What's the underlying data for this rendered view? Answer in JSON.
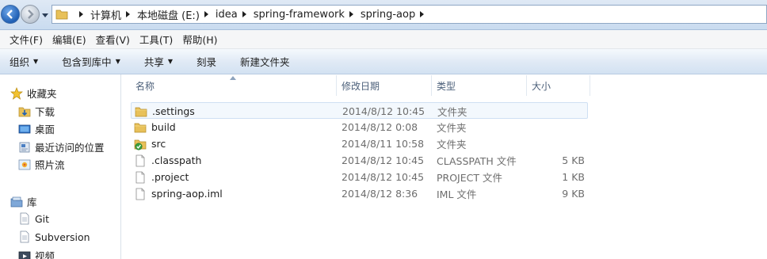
{
  "address": {
    "crumbs": [
      "计算机",
      "本地磁盘 (E:)",
      "idea",
      "spring-framework",
      "spring-aop"
    ]
  },
  "menu": [
    "文件(F)",
    "编辑(E)",
    "查看(V)",
    "工具(T)",
    "帮助(H)"
  ],
  "commands": [
    {
      "label": "组织",
      "dropdown": true
    },
    {
      "label": "包含到库中",
      "dropdown": true
    },
    {
      "label": "共享",
      "dropdown": true
    },
    {
      "label": "刻录",
      "dropdown": false
    },
    {
      "label": "新建文件夹",
      "dropdown": false
    }
  ],
  "nav": {
    "favorites_label": "收藏夹",
    "favorites": [
      "下载",
      "桌面",
      "最近访问的位置",
      "照片流"
    ],
    "library_label": "库",
    "libraries": [
      "Git",
      "Subversion",
      "视频"
    ]
  },
  "columns": {
    "name": "名称",
    "date": "修改日期",
    "type": "类型",
    "size": "大小"
  },
  "files": [
    {
      "name": ".settings",
      "date": "2014/8/12 10:45",
      "type": "文件夹",
      "size": "",
      "icon": "folder-icon",
      "selected": true
    },
    {
      "name": "build",
      "date": "2014/8/12 0:08",
      "type": "文件夹",
      "size": "",
      "icon": "folder-icon",
      "selected": false
    },
    {
      "name": "src",
      "date": "2014/8/11 10:58",
      "type": "文件夹",
      "size": "",
      "icon": "folder-sync-icon",
      "selected": false
    },
    {
      "name": ".classpath",
      "date": "2014/8/12 10:45",
      "type": "CLASSPATH 文件",
      "size": "5 KB",
      "icon": "file-icon",
      "selected": false
    },
    {
      "name": ".project",
      "date": "2014/8/12 10:45",
      "type": "PROJECT 文件",
      "size": "1 KB",
      "icon": "file-icon",
      "selected": false
    },
    {
      "name": "spring-aop.iml",
      "date": "2014/8/12 8:36",
      "type": "IML 文件",
      "size": "9 KB",
      "icon": "file-icon",
      "selected": false
    }
  ],
  "colors": {
    "accent": "#1f5fb4",
    "selection": "#cfe0f3",
    "folder": "#e8c15a"
  }
}
